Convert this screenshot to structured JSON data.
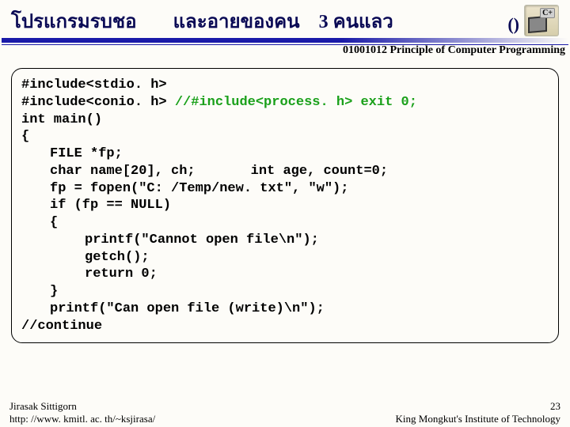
{
  "header": {
    "title_seg1": "โปรแกรมรบชอ",
    "title_seg2": "และอายของคน",
    "title_seg3": "3 คนแลว",
    "parens": "()",
    "badge_small": "C+"
  },
  "course_line": "01001012 Principle of Computer Programming",
  "code": {
    "l1_a": "#include<stdio. h>",
    "l2_a": "#include<conio. h> ",
    "l2_b": "//#include<process. h> exit 0;",
    "l3": "int main()",
    "l4": "{",
    "l5": "FILE *fp;",
    "l6_a": "char name[20], ch;",
    "l6_b": "int  age, count=0;",
    "l7": "fp = fopen(\"C: /Temp/new. txt\", \"w\");",
    "l8": "if (fp == NULL)",
    "l9": "{",
    "l10": "printf(\"Cannot open file\\n\");",
    "l11": "getch();",
    "l12": "return 0;",
    "l13": "}",
    "l14": "printf(\"Can open file (write)\\n\");",
    "l15": "//continue"
  },
  "footer": {
    "author": "Jirasak Sittigorn",
    "url": "http: //www. kmitl. ac. th/~ksjirasa/",
    "page": "23",
    "inst": "King Mongkut's Institute of Technology"
  }
}
